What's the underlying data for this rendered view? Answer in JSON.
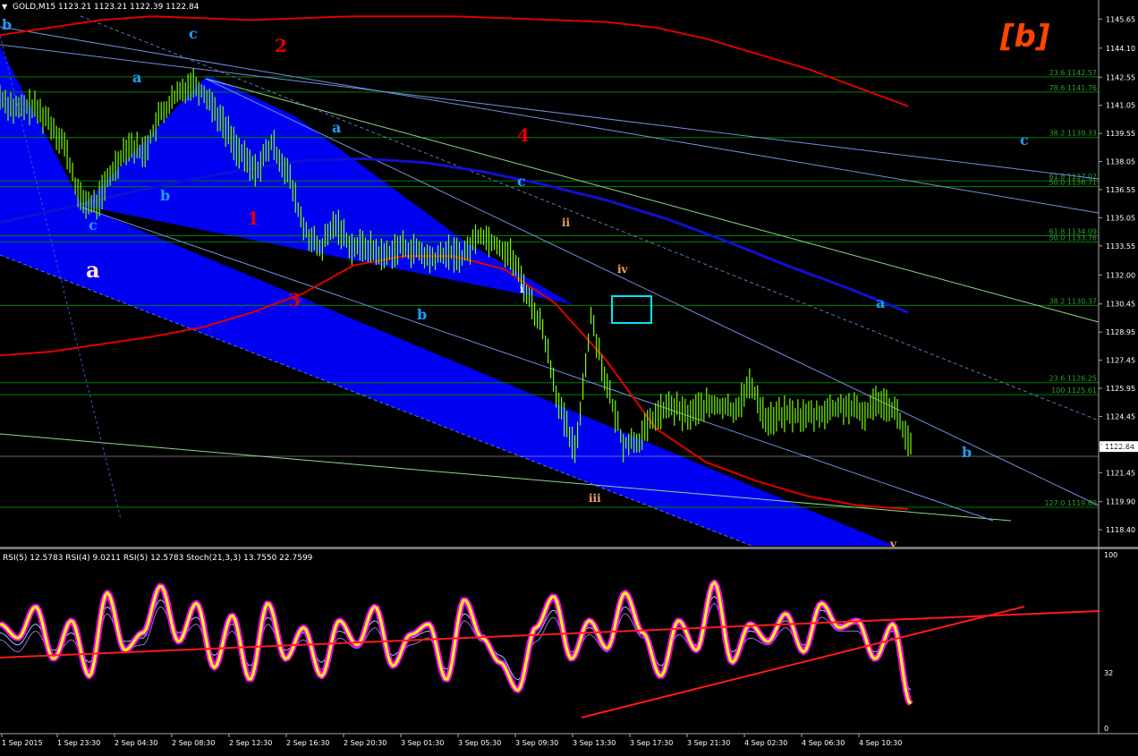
{
  "header": {
    "symbol_line": "GOLD,M15  1123.21 1123.21 1122.39 1122.84",
    "indicator_line": "RSI(5) 12.5783  RSI(4) 9.0211  RSI(5) 12.5783  Stoch(21,3,3) 13.7550 22.7599",
    "watermark": "[b]"
  },
  "colors": {
    "background": "#000000",
    "price": "#7cfc00",
    "bollinger": "#e00000",
    "moving_average": "#1010d0",
    "channel_fill": "#0000ff",
    "fib_line": "#008000",
    "trendline": "#6f8fe0",
    "rsi_main": "#ffff00",
    "rsi_glow": "#ff00ff",
    "watermark": "#ff4500"
  },
  "chart_data": [
    {
      "type": "line",
      "name": "price-panel",
      "ylim": [
        1117.5,
        1146.0
      ],
      "price_axis_ticks": [
        "1145.65",
        "1144.10",
        "1142.55",
        "1141.05",
        "1139.55",
        "1138.05",
        "1136.55",
        "1135.05",
        "1133.55",
        "1132.00",
        "1130.45",
        "1128.95",
        "1127.45",
        "1125.95",
        "1124.45",
        "1122.95",
        "1121.45",
        "1119.90",
        "1118.40"
      ],
      "current_price": "1122.84",
      "fib_levels": [
        {
          "label": "23.6 1142.57",
          "price": 1142.57
        },
        {
          "label": "78.6 1141.76",
          "price": 1141.76
        },
        {
          "label": "38.2 1139.33",
          "price": 1139.33
        },
        {
          "label": "61.8 1137.02",
          "price": 1137.02
        },
        {
          "label": "50.0 1136.71",
          "price": 1136.71
        },
        {
          "label": "61.8 1134.09",
          "price": 1134.09
        },
        {
          "label": "50.0 1133.76",
          "price": 1133.76
        },
        {
          "label": "38.2 1130.37",
          "price": 1130.37
        },
        {
          "label": "23.6 1126.25",
          "price": 1126.25
        },
        {
          "label": "100 1125.61",
          "price": 1125.61
        },
        {
          "label": "127.0 1119.60",
          "price": 1119.6
        }
      ],
      "price_series": [
        1141.5,
        1140.8,
        1141.0,
        1140.3,
        1139.0,
        1136.0,
        1135.7,
        1137.5,
        1139.0,
        1138.5,
        1140.5,
        1141.5,
        1142.3,
        1141.5,
        1140.0,
        1138.5,
        1137.5,
        1139.0,
        1137.5,
        1134.5,
        1133.3,
        1134.8,
        1133.5,
        1133.5,
        1133.0,
        1133.5,
        1133.3,
        1132.8,
        1133.2,
        1133.0,
        1134.2,
        1133.7,
        1133.0,
        1131.0,
        1129.0,
        1125.0,
        1122.5,
        1129.8,
        1126.0,
        1123.0,
        1123.2,
        1124.5,
        1125.0,
        1124.5,
        1125.0,
        1125.0,
        1124.8,
        1126.2,
        1124.2,
        1124.6,
        1124.5,
        1124.5,
        1124.8,
        1125.0,
        1124.5,
        1125.4,
        1124.8,
        1122.8
      ],
      "bollinger_upper": [
        1144.8,
        1145.2,
        1145.6,
        1145.8,
        1145.7,
        1145.6,
        1145.7,
        1145.8,
        1145.8,
        1145.8,
        1145.7,
        1145.6,
        1145.5,
        1145.2,
        1144.6,
        1143.8,
        1143.0,
        1142.0,
        1141.0
      ],
      "bollinger_lower": [
        1127.7,
        1127.9,
        1128.3,
        1128.7,
        1129.2,
        1130.0,
        1131.0,
        1132.5,
        1133.0,
        1133.0,
        1132.3,
        1130.5,
        1127.5,
        1123.8,
        1122.0,
        1121.0,
        1120.2,
        1119.7,
        1119.5
      ],
      "moving_average": [
        1134.8,
        1135.5,
        1136.3,
        1137.0,
        1137.6,
        1138.1,
        1138.2,
        1138.0,
        1137.5,
        1136.8,
        1136.0,
        1135.0,
        1133.8,
        1132.5,
        1131.3,
        1130.0
      ],
      "wave_labels": [
        {
          "text": "b",
          "color": "#1e9fff",
          "size": 16
        },
        {
          "text": "c",
          "color": "#1e9fff",
          "size": 16
        },
        {
          "text": "2",
          "color": "#e00000",
          "size": 20
        },
        {
          "text": "a",
          "color": "#1e9fff",
          "size": 16
        },
        {
          "text": "a",
          "color": "#1e9fff",
          "size": 16
        },
        {
          "text": "4",
          "color": "#e00000",
          "size": 20
        },
        {
          "text": "c",
          "color": "#1e9fff",
          "size": 16
        },
        {
          "text": "c",
          "color": "#1e9fff",
          "size": 16
        },
        {
          "text": "b",
          "color": "#1e9fff",
          "size": 16
        },
        {
          "text": "c",
          "color": "#1e9fff",
          "size": 16
        },
        {
          "text": "1",
          "color": "#e00000",
          "size": 20
        },
        {
          "text": "a",
          "color": "#ffe4c4",
          "size": 24
        },
        {
          "text": "ii",
          "color": "#f4a460",
          "size": 12
        },
        {
          "text": "iv",
          "color": "#f4a460",
          "size": 12
        },
        {
          "text": "i",
          "color": "#ffffff",
          "size": 12
        },
        {
          "text": "3",
          "color": "#e00000",
          "size": 20
        },
        {
          "text": "b",
          "color": "#1e9fff",
          "size": 16
        },
        {
          "text": "a",
          "color": "#1e9fff",
          "size": 16
        },
        {
          "text": "iii",
          "color": "#f4a460",
          "size": 12
        },
        {
          "text": "b",
          "color": "#1e9fff",
          "size": 16
        },
        {
          "text": "v",
          "color": "#f4a460",
          "size": 12
        }
      ]
    },
    {
      "type": "line",
      "name": "oscillator-panel",
      "ylim": [
        0,
        100
      ],
      "axis_ticks": [
        "100",
        "32",
        "0"
      ],
      "series": [
        {
          "name": "RSI(5)",
          "values": [
            60,
            52,
            70,
            40,
            62,
            30,
            78,
            45,
            55,
            82,
            50,
            72,
            35,
            65,
            28,
            72,
            40,
            58,
            30,
            62,
            48,
            70,
            36,
            54,
            60,
            28,
            74,
            52,
            38,
            22,
            58,
            76,
            40,
            62,
            46,
            78,
            55,
            30,
            62,
            45,
            84,
            38,
            60,
            50,
            66,
            44,
            72,
            58,
            62,
            40,
            60,
            14
          ]
        },
        {
          "name": "Stoch(21,3,3)",
          "values": [
            55,
            48,
            60,
            45,
            55,
            38,
            70,
            50,
            52,
            74,
            55,
            64,
            42,
            60,
            36,
            64,
            45,
            55,
            38,
            56,
            50,
            62,
            42,
            52,
            56,
            34,
            66,
            54,
            42,
            28,
            54,
            68,
            44,
            58,
            48,
            70,
            56,
            36,
            58,
            48,
            76,
            44,
            56,
            52,
            62,
            48,
            68,
            60,
            60,
            44,
            56,
            22
          ]
        }
      ],
      "trendlines": [
        "rising support",
        "flat resistance"
      ]
    }
  ],
  "x_axis_labels": [
    "1 Sep 2015",
    "1 Sep 23:30",
    "2 Sep 04:30",
    "2 Sep 08:30",
    "2 Sep 12:30",
    "2 Sep 16:30",
    "2 Sep 20:30",
    "3 Sep 01:30",
    "3 Sep 05:30",
    "3 Sep 09:30",
    "3 Sep 13:30",
    "3 Sep 17:30",
    "3 Sep 21:30",
    "4 Sep 02:30",
    "4 Sep 06:30",
    "4 Sep 10:30"
  ]
}
